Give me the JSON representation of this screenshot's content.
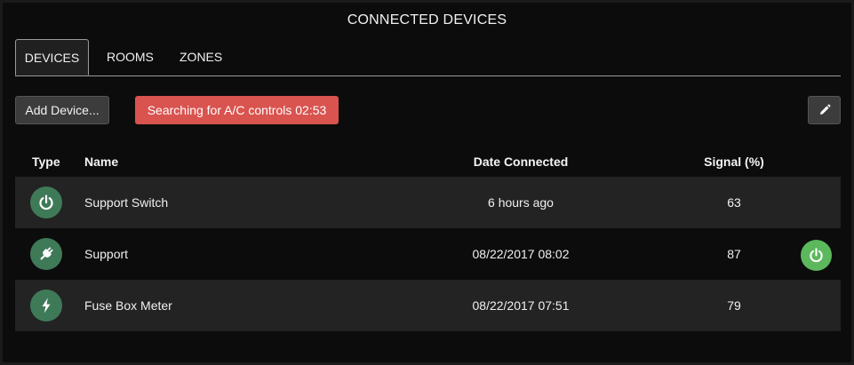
{
  "header": {
    "title": "CONNECTED DEVICES"
  },
  "tabs": [
    {
      "label": "DEVICES",
      "active": true
    },
    {
      "label": "ROOMS",
      "active": false
    },
    {
      "label": "ZONES",
      "active": false
    }
  ],
  "toolbar": {
    "add_label": "Add Device...",
    "search_status": "Searching for A/C controls 02:53",
    "edit_icon": "pencil-icon"
  },
  "table": {
    "columns": [
      "Type",
      "Name",
      "Date Connected",
      "Signal (%)"
    ],
    "rows": [
      {
        "type_icon": "power-icon",
        "name": "Support Switch",
        "date": "6 hours ago",
        "signal": "63",
        "has_action": false
      },
      {
        "type_icon": "plug-icon",
        "name": "Support",
        "date": "08/22/2017 08:02",
        "signal": "87",
        "has_action": true,
        "action_icon": "power-icon"
      },
      {
        "type_icon": "lightning-icon",
        "name": "Fuse Box Meter",
        "date": "08/22/2017 07:51",
        "signal": "79",
        "has_action": false
      }
    ]
  },
  "colors": {
    "panel": "#0c0c0c",
    "row_alt": "#232323",
    "type_icon_bg": "#3f7a58",
    "search_badge": "#d9534f",
    "action_button": "#5cb85c"
  }
}
